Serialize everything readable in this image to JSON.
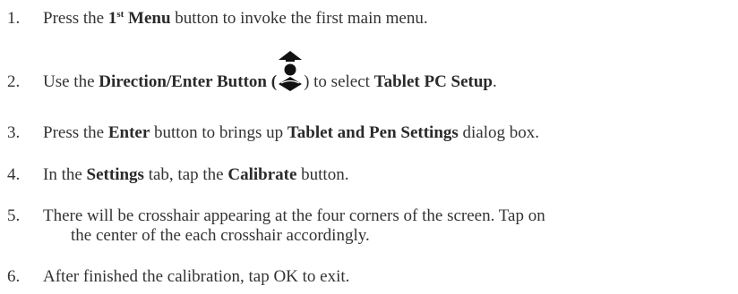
{
  "steps": [
    {
      "num": "1.",
      "parts": [
        "Press the ",
        "1",
        "st",
        " Menu",
        " button to invoke the first main menu."
      ]
    },
    {
      "num": "2.",
      "parts": [
        "Use the ",
        "Direction/Enter Button (",
        ") to select ",
        "Tablet PC Setup",
        "."
      ],
      "icon": "direction-enter-icon"
    },
    {
      "num": "3.",
      "parts": [
        "Press the ",
        "Enter",
        " button to brings up ",
        "Tablet and Pen Settings",
        " dialog box."
      ]
    },
    {
      "num": "4.",
      "parts": [
        "In the ",
        "Settings",
        " tab, tap the ",
        "Calibrate",
        " button."
      ]
    },
    {
      "num": "5.",
      "parts": [
        "There will be crosshair appearing at the four corners of the screen. Tap on"
      ],
      "continuation": "the center of the each crosshair accordingly."
    },
    {
      "num": "6.",
      "parts": [
        "After finished the calibration, tap OK to exit."
      ]
    }
  ]
}
